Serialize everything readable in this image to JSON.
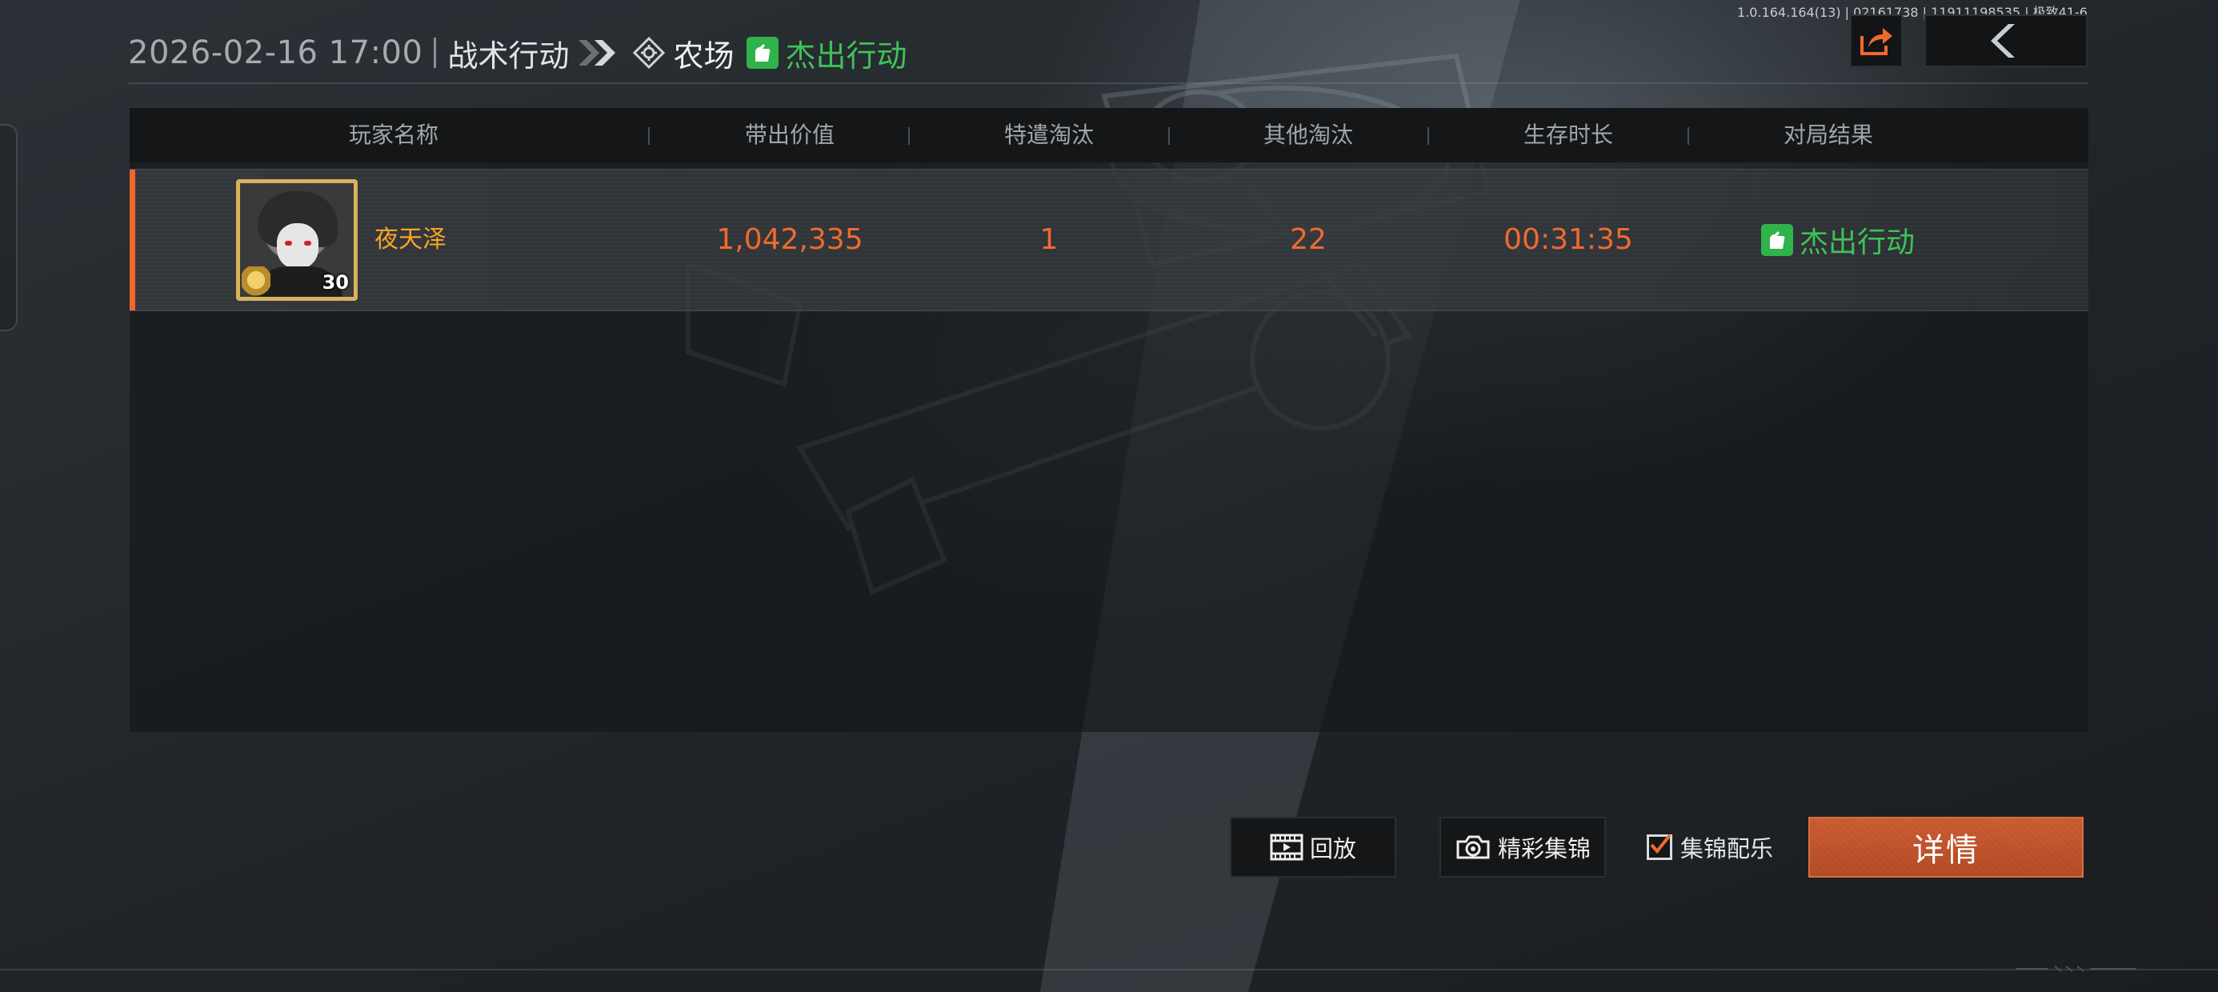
{
  "version_info": "1.0.164.164(13) | 02161738 | 11911198535 | 极致41-6",
  "header": {
    "datetime": "2026-02-16 17:00",
    "mode": "战术行动",
    "map": "农场",
    "result": "杰出行动"
  },
  "table": {
    "columns": [
      "玩家名称",
      "带出价值",
      "特遣淘汰",
      "其他淘汰",
      "生存时长",
      "对局结果"
    ],
    "rows": [
      {
        "player_name": "夜天泽",
        "level": "30",
        "extraction_value": "1,042,335",
        "special_kills": "1",
        "other_kills": "22",
        "survival_time": "00:31:35",
        "result": "杰出行动"
      }
    ]
  },
  "actions": {
    "replay_label": "回放",
    "highlights_label": "精彩集锦",
    "music_label": "集锦配乐",
    "music_checked": true,
    "details_label": "详情"
  },
  "colors": {
    "accent_orange": "#f06a2e",
    "result_green": "#3fc158",
    "name_gold": "#f5a623",
    "details_button": "#c0542b"
  },
  "icons": {
    "share": "share-icon",
    "back": "back-arrow-icon",
    "map": "map-marker-icon",
    "result": "hand-icon",
    "replay": "film-icon",
    "highlights": "camera-icon"
  }
}
